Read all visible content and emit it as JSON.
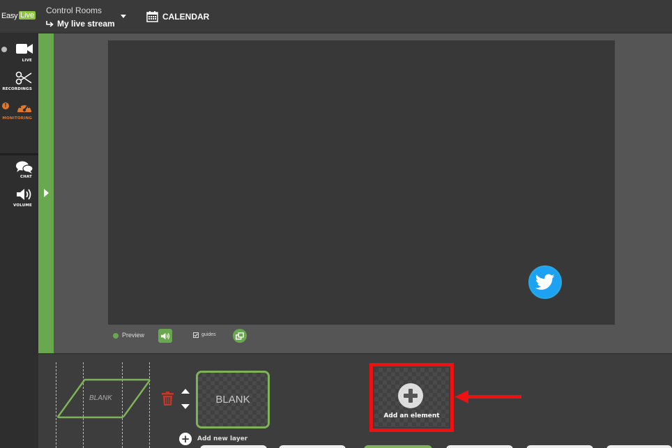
{
  "topbar": {
    "logo_easy": "Easy",
    "logo_live": "Live",
    "control_rooms": "Control Rooms",
    "stream_name": "My live stream",
    "calendar_label": "CALENDAR"
  },
  "sidebar": {
    "items": [
      {
        "label": "LIVE",
        "icon": "video-camera-icon"
      },
      {
        "label": "RECORDINGS",
        "icon": "scissors-icon"
      },
      {
        "label": "MONITORING",
        "icon": "dashboard-icon"
      },
      {
        "label": "CHAT",
        "icon": "chat-bubbles-icon"
      },
      {
        "label": "VOLUME",
        "icon": "speaker-icon"
      }
    ],
    "monitoring_alert": "!"
  },
  "stage": {
    "preview_label": "Preview",
    "guides_label": "guides",
    "guides_checked": true,
    "overlay_icon": "twitter-icon"
  },
  "layers": {
    "blank_shape_label": "BLANK",
    "layer_label": "BLANK",
    "add_layer_label": "Add new layer",
    "add_element_label": "Add an element"
  },
  "colors": {
    "accent_green": "#6aa84f",
    "monitoring_orange": "#e0782d",
    "highlight_red": "#ee1111",
    "twitter_blue": "#1da1f2",
    "trash_red": "#c0392b"
  }
}
